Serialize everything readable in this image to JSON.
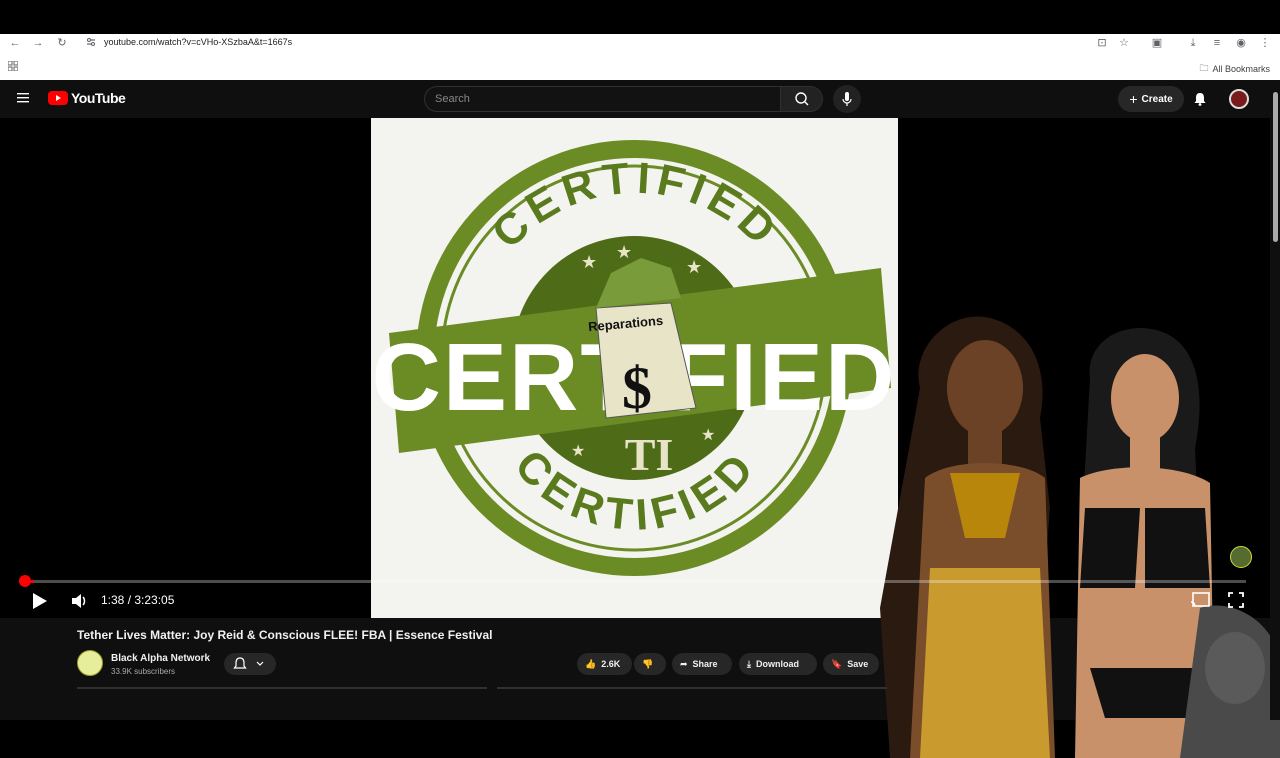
{
  "browser": {
    "url": "youtube.com/watch?v=cVHo-XSzbaA&t=1667s",
    "bookmarks_label": "All Bookmarks"
  },
  "youtube": {
    "logo_text": "YouTube",
    "search_placeholder": "Search",
    "create_label": "Create"
  },
  "player": {
    "time_display": "1:38 / 3:23:05",
    "progress_fraction": 0.008,
    "thumbnail": {
      "top_arc": "CERTIFIED",
      "bottom_arc": "CERTIFIED",
      "center_text": "CERTIFIED",
      "bag_label": "Reparations",
      "symbol": "$",
      "bottom_center": "TI"
    }
  },
  "video": {
    "title": "Tether Lives Matter: Joy Reid & Conscious FLEE! FBA | Essence Festival",
    "channel_name": "Black Alpha Network",
    "subscribers": "33.9K subscribers",
    "likes": "2.6K",
    "share_label": "Share",
    "download_label": "Download",
    "save_label": "Save"
  },
  "colors": {
    "accent_red": "#ff0000",
    "stamp_green": "#5a7a1e",
    "bg": "#0f0f0f"
  }
}
